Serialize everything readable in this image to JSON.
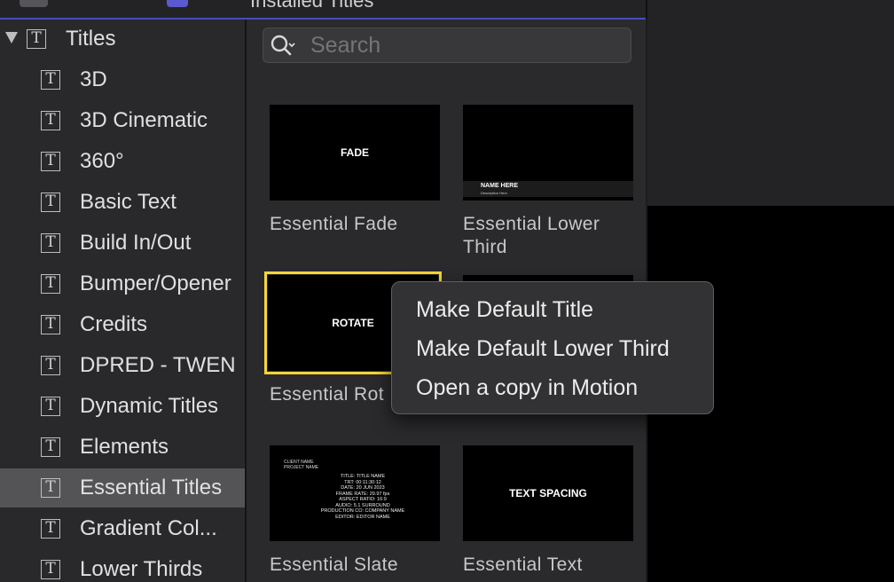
{
  "toolbar": {
    "title": "Installed Titles",
    "icons": [
      "star-icon",
      "music-note-icon",
      "titles-icon"
    ]
  },
  "sidebar": {
    "parent": {
      "label": "Titles",
      "icon": "title-T-icon"
    },
    "items": [
      {
        "label": "3D"
      },
      {
        "label": "3D Cinematic"
      },
      {
        "label": "360°"
      },
      {
        "label": "Basic Text"
      },
      {
        "label": "Build In/Out"
      },
      {
        "label": "Bumper/Opener"
      },
      {
        "label": "Credits"
      },
      {
        "label": "DPRED - TWEN"
      },
      {
        "label": "Dynamic Titles"
      },
      {
        "label": "Elements"
      },
      {
        "label": "Essential Titles",
        "selected": true
      },
      {
        "label": "Gradient Col..."
      },
      {
        "label": "Lower Thirds"
      }
    ]
  },
  "search": {
    "placeholder": "Search",
    "value": ""
  },
  "thumbnails": [
    {
      "thumb_text": "FADE",
      "caption": "Essential Fade"
    },
    {
      "thumb_name": "NAME HERE",
      "thumb_desc": "Description Here",
      "caption": "Essential Lower Third"
    },
    {
      "thumb_text": "ROTATE",
      "caption": "Essential Rot",
      "selected": true
    },
    {
      "caption": ""
    },
    {
      "thumb_header": "CLIENT NAME\nPROJECT NAME",
      "thumb_body": "TITLE: TITLE NAME\nTRT: 00:11:30:12\nDATE: 20 JUN 2023\nFRAME RATE: 29.97 fps\nASPECT RATIO: 16:9\nAUDIO: 5.1 SURROUND\nPRODUCTION CO: COMPANY NAME\nEDITOR: EDITOR NAME",
      "caption": "Essential Slate"
    },
    {
      "thumb_text": "TEXT SPACING",
      "caption": "Essential Text"
    }
  ],
  "context_menu": {
    "items": [
      {
        "label": "Make Default Title"
      },
      {
        "label": "Make Default Lower Third"
      },
      {
        "label": "Open a copy in Motion"
      }
    ]
  },
  "colors": {
    "selection_outline": "#f5d53a",
    "accent_bar": "#4a4bbd",
    "sidebar_selected": "#545456"
  }
}
